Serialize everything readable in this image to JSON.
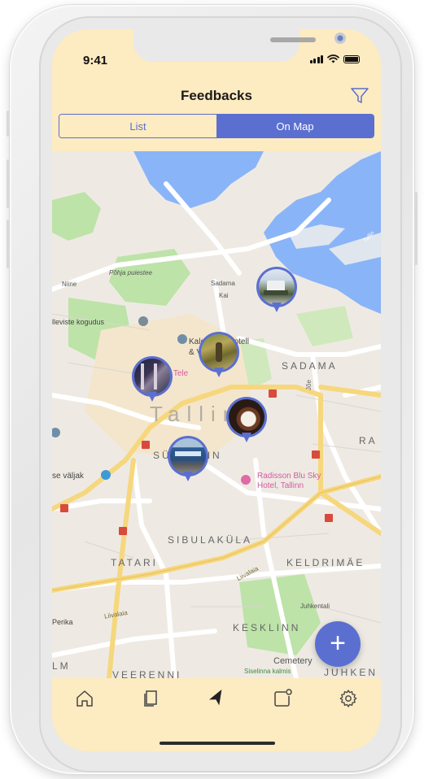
{
  "status": {
    "time": "9:41"
  },
  "header": {
    "title": "Feedbacks"
  },
  "segmented": {
    "list_label": "List",
    "map_label": "On Map",
    "selected": "On Map"
  },
  "map": {
    "labels": {
      "pohja": "Põhja puiestee",
      "sadama_st": "Sadama",
      "kai": "Kai",
      "niine": "Niine",
      "kogudus": "lleviste kogudus",
      "kalev": "Kalev Spa Hotell",
      "kalev2": "& Veekeskus",
      "sadama_district": "SADAMA",
      "tele": "l Tele",
      "tallinn": "Tallinn",
      "joe": "Jõe",
      "ra": "RA",
      "sudalinn": "SÜDALINN",
      "radisson": "Radisson Blu Sky",
      "radisson2": "Hotel, Tallinn",
      "valjak": "se väljak",
      "sibulakula": "SIBULAKÜLA",
      "tatari": "TATARI",
      "keldrimae": "KELDRIMÄE",
      "liivalaia": "Liivalaia",
      "liivalaia2": "Liivalaia",
      "erika": "Perika",
      "juhkentali": "Juhkentali",
      "kesklinn": "KESKLINN",
      "cemetery": "Cemetery",
      "siselinna": "Siselinna kalmis",
      "veerenni": "VEERENNI",
      "lm": "LM",
      "juhken": "JUHKEN",
      "tallin_top": "Tallin"
    },
    "markers": [
      {
        "name": "marker-harbour",
        "photo": "harbour"
      },
      {
        "name": "marker-park",
        "photo": "park"
      },
      {
        "name": "marker-interior",
        "photo": "interior"
      },
      {
        "name": "marker-food",
        "photo": "food"
      },
      {
        "name": "marker-tram",
        "photo": "tram"
      }
    ]
  },
  "fab": {
    "label": "+"
  },
  "tabbar": {
    "items": [
      {
        "name": "home-icon"
      },
      {
        "name": "pages-icon"
      },
      {
        "name": "navigation-icon",
        "active": true
      },
      {
        "name": "notification-icon"
      },
      {
        "name": "settings-icon"
      }
    ]
  },
  "colors": {
    "accent": "#5b6fd0",
    "header_bg": "#fdebc1",
    "map_bg": "#eeeae3",
    "water": "#8ab4f8",
    "park": "#bde3a8",
    "road": "#f6d77d"
  }
}
